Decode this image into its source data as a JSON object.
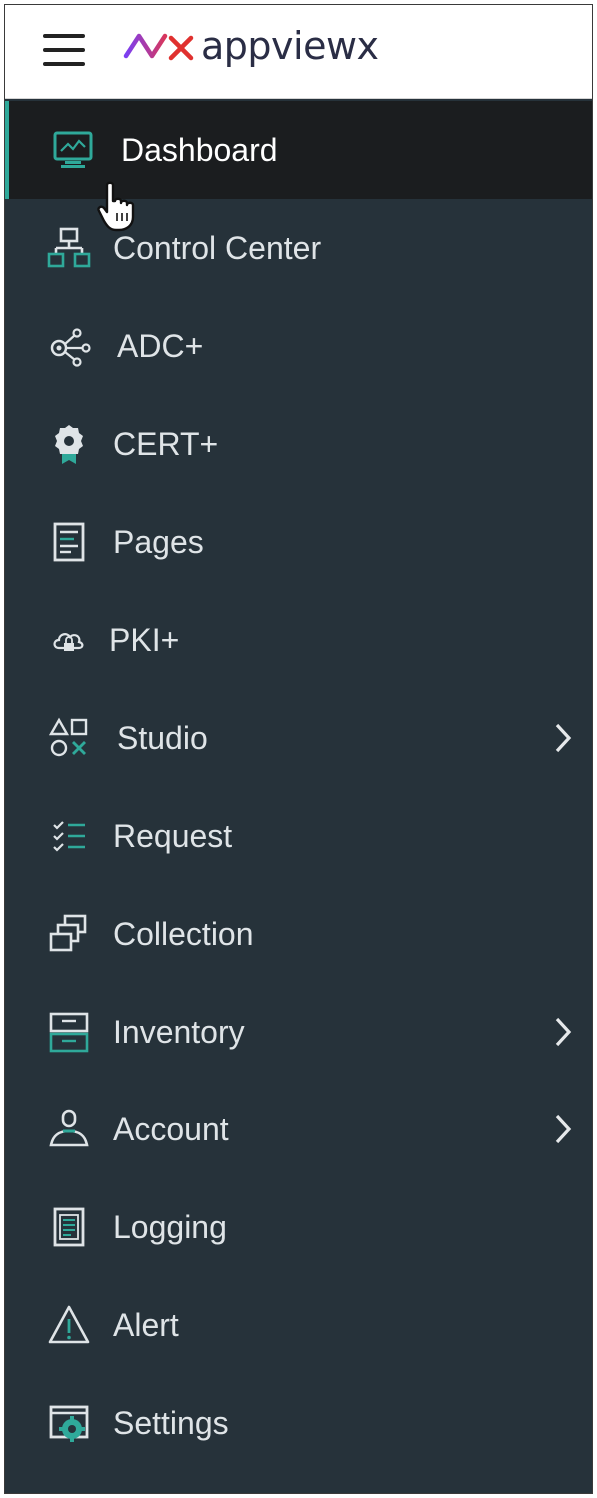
{
  "header": {
    "brand": "appviewx",
    "logo_mark_colors": [
      "#7b3ff2",
      "#e0312f"
    ],
    "menu_icon": "hamburger-icon"
  },
  "theme": {
    "sidebar_bg": "#26323a",
    "active_bg": "#1b1d1f",
    "accent": "#2fa99a",
    "text": "#dfe4e7"
  },
  "sidebar": {
    "active_item": "Dashboard",
    "items": [
      {
        "label": "Dashboard",
        "icon": "monitor-chart-icon",
        "has_submenu": false
      },
      {
        "label": "Control Center",
        "icon": "hierarchy-icon",
        "has_submenu": false
      },
      {
        "label": "ADC+",
        "icon": "network-nodes-icon",
        "has_submenu": false
      },
      {
        "label": "CERT+",
        "icon": "certificate-badge-icon",
        "has_submenu": false
      },
      {
        "label": "Pages",
        "icon": "page-document-icon",
        "has_submenu": false
      },
      {
        "label": "PKI+",
        "icon": "cloud-lock-icon",
        "has_submenu": false
      },
      {
        "label": "Studio",
        "icon": "shapes-icon",
        "has_submenu": true
      },
      {
        "label": "Request",
        "icon": "checklist-icon",
        "has_submenu": false
      },
      {
        "label": "Collection",
        "icon": "stacked-windows-icon",
        "has_submenu": false
      },
      {
        "label": "Inventory",
        "icon": "archive-drawers-icon",
        "has_submenu": true
      },
      {
        "label": "Account",
        "icon": "user-account-icon",
        "has_submenu": true
      },
      {
        "label": "Logging",
        "icon": "log-file-icon",
        "has_submenu": false
      },
      {
        "label": "Alert",
        "icon": "warning-triangle-icon",
        "has_submenu": false
      },
      {
        "label": "Settings",
        "icon": "settings-gear-window-icon",
        "has_submenu": false
      }
    ]
  }
}
